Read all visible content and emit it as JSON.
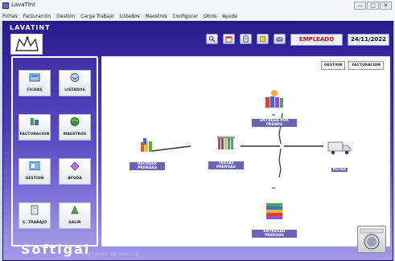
{
  "window": {
    "title": "LavaTint",
    "buttons": [
      "—",
      "□",
      "✕"
    ]
  },
  "menu": [
    "Fichas",
    "Facturación",
    "Gestión",
    "Carga Trabajo",
    "Listados",
    "Maestros",
    "Configurar",
    "Otros",
    "Ayuda"
  ],
  "header": {
    "brand": "LAVATINT",
    "user_role": "EMPLEADO",
    "date": "24/11/2022",
    "toolbar_icons": [
      "search-icon",
      "calendar-icon",
      "document-icon",
      "notes-icon",
      "mail-icon"
    ]
  },
  "nav": [
    {
      "label": "FICHAS",
      "icon": "fichas-icon",
      "color": "#4a7fd1"
    },
    {
      "label": "LISTADOS",
      "icon": "listados-icon",
      "color": "#6b7f9f"
    },
    {
      "label": "FACTURACION",
      "icon": "facturacion-icon",
      "color": "#3c7a5c"
    },
    {
      "label": "MAESTROS",
      "icon": "maestros-icon",
      "color": "#3a8e3a"
    },
    {
      "label": "GESTION",
      "icon": "gestion-icon",
      "color": "#2f79c8"
    },
    {
      "label": "AYUDA",
      "icon": "ayuda-icon",
      "color": "#8a3bb5"
    },
    {
      "label": "C. TRABAJO",
      "icon": "trabajo-icon",
      "color": "#7b7b88"
    },
    {
      "label": "SALIR",
      "icon": "salir-icon",
      "color": "#3c8a3c"
    }
  ],
  "tabs": [
    "GESTION",
    "FACTURACION"
  ],
  "workflow": {
    "recoger": "RECOGER PRENDAS",
    "tratar": "TRATAR PRENDAS",
    "entrega_por_prenda": "ENTREGA POR PRENDA",
    "entregar": "ENTREGAR PRENDAS",
    "rutas": "RUTAS"
  },
  "footer": {
    "logo": "Softigal",
    "subtitle": "SOFTWARE DE GALICIA"
  },
  "colors": {
    "accent": "#d11111",
    "panel_gradient_top": "#2a1a8a",
    "panel_gradient_bottom": "#a59ae8"
  }
}
